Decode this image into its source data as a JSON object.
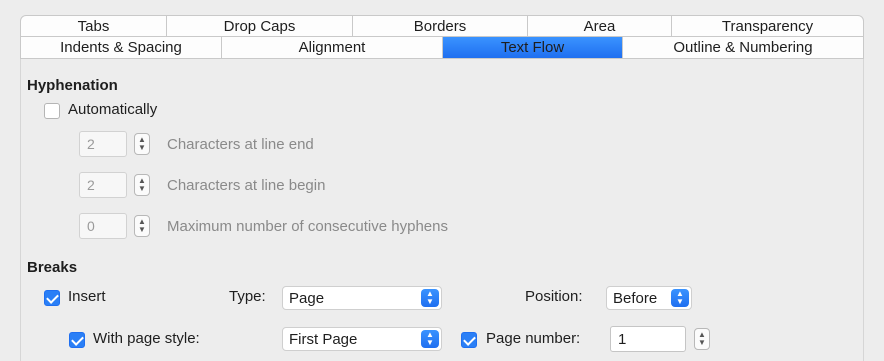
{
  "tabs_row1": [
    "Tabs",
    "Drop Caps",
    "Borders",
    "Area",
    "Transparency"
  ],
  "tabs_row2": [
    "Indents & Spacing",
    "Alignment",
    "Text Flow",
    "Outline & Numbering"
  ],
  "active_tab": "Text Flow",
  "hyphenation": {
    "title": "Hyphenation",
    "automatically_label": "Automatically",
    "automatically_checked": false,
    "line_end_value": "2",
    "line_end_label": "Characters at line end",
    "line_begin_value": "2",
    "line_begin_label": "Characters at line begin",
    "max_hyphens_value": "0",
    "max_hyphens_label": "Maximum number of consecutive hyphens"
  },
  "breaks": {
    "title": "Breaks",
    "insert_label": "Insert",
    "insert_checked": true,
    "type_label": "Type:",
    "type_value": "Page",
    "position_label": "Position:",
    "position_value": "Before",
    "page_style_label": "With page style:",
    "page_style_checked": true,
    "page_style_value": "First Page",
    "page_number_label": "Page number:",
    "page_number_checked": true,
    "page_number_value": "1"
  },
  "colors": {
    "accent": "#2a7ff6",
    "background": "#ededed",
    "disabled_text": "#8a8a8a"
  },
  "icons": {
    "spin": "up-down-chevron-icon",
    "dropdown": "dropdown-chevron-icon",
    "check": "checkmark-icon"
  }
}
